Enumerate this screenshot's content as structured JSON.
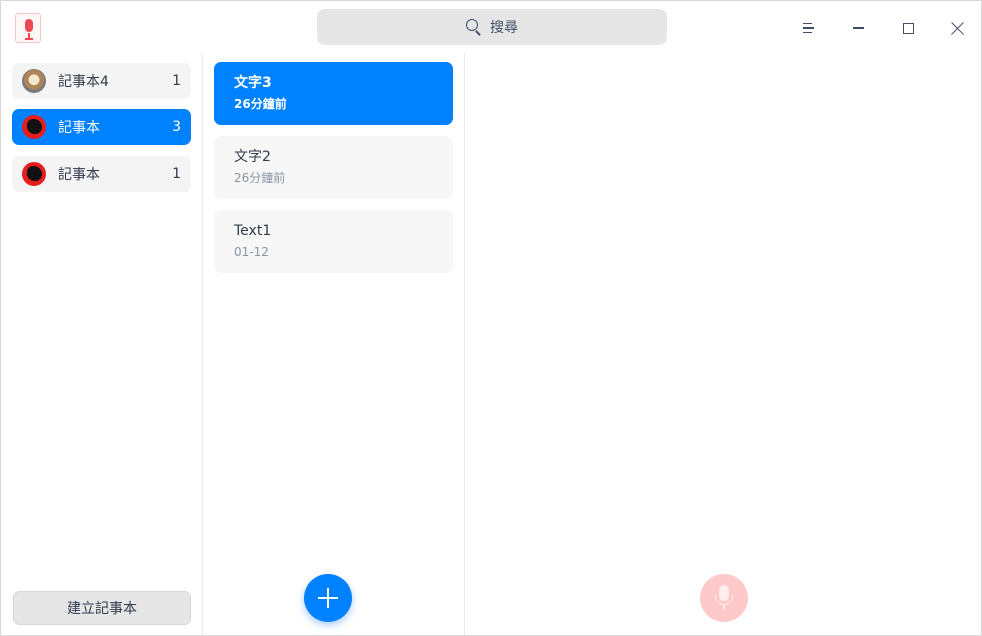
{
  "search": {
    "label": "搜尋"
  },
  "notebooks": {
    "items": [
      {
        "name": "記事本4",
        "count": "1",
        "avatar": "latte-avatar-icon",
        "active": false
      },
      {
        "name": "記事本",
        "count": "3",
        "avatar": "red-avatar-icon",
        "active": true
      },
      {
        "name": "記事本",
        "count": "1",
        "avatar": "red-avatar-icon",
        "active": false
      }
    ],
    "create_label": "建立記事本"
  },
  "notes": {
    "items": [
      {
        "title": "文字3",
        "time": "26分鐘前",
        "active": true
      },
      {
        "title": "文字2",
        "time": "26分鐘前",
        "active": false
      },
      {
        "title": "Text1",
        "time": "01-12",
        "active": false
      }
    ]
  },
  "colors": {
    "accent": "#0081ff",
    "voice_button": "#ffc9c9",
    "app_icon_red": "#ee4a55"
  }
}
